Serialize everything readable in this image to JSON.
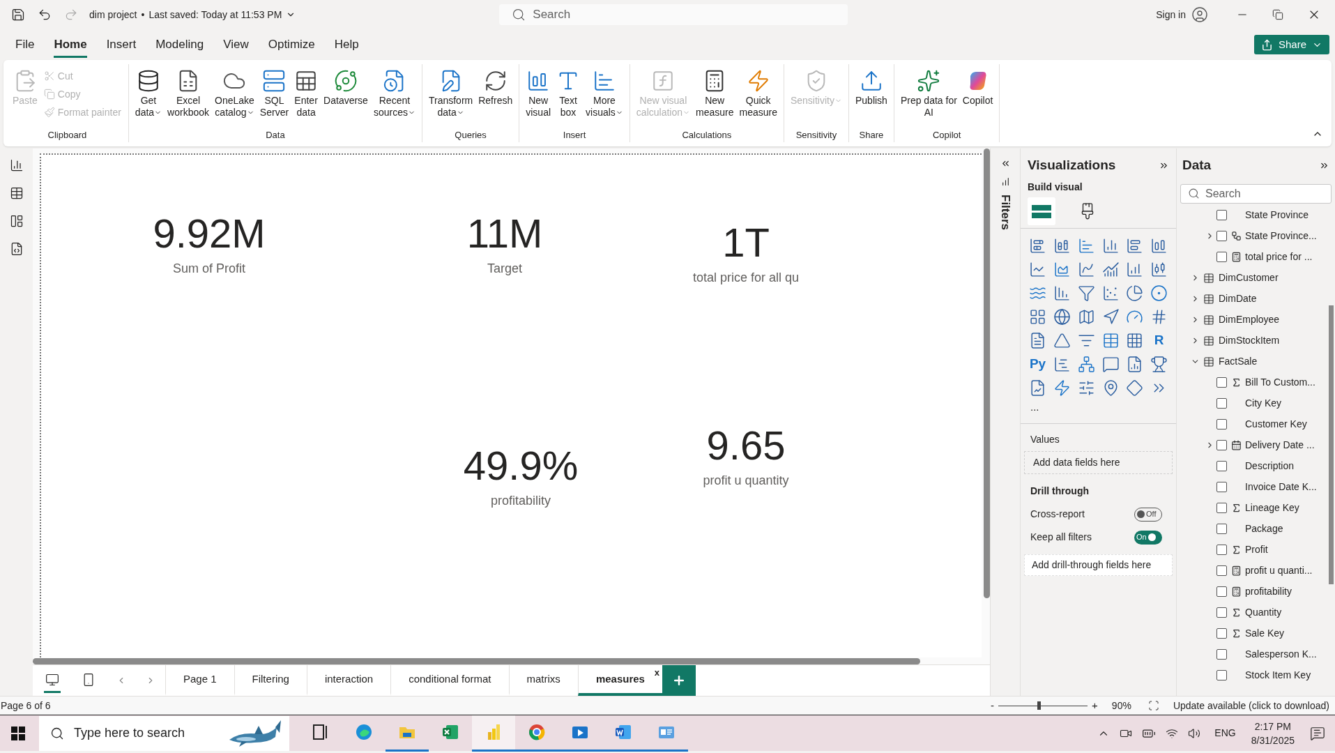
{
  "title_bar": {
    "file_name": "dim project",
    "separator": "•",
    "saved_status": "Last saved: Today at 11:53 PM",
    "search_placeholder": "Search",
    "sign_in": "Sign in"
  },
  "menu_tabs": [
    {
      "label": "File",
      "selected": false
    },
    {
      "label": "Home",
      "selected": true
    },
    {
      "label": "Insert",
      "selected": false
    },
    {
      "label": "Modeling",
      "selected": false
    },
    {
      "label": "View",
      "selected": false
    },
    {
      "label": "Optimize",
      "selected": false
    },
    {
      "label": "Help",
      "selected": false
    }
  ],
  "share_button": "Share",
  "ribbon": {
    "groups": [
      {
        "label": "Clipboard",
        "items": [
          {
            "kind": "large",
            "lines": [
              "Paste"
            ],
            "dropdown": false,
            "disabled": true
          },
          {
            "kind": "small",
            "lines": [
              "Cut"
            ],
            "disabled": true
          },
          {
            "kind": "small",
            "lines": [
              "Copy"
            ],
            "disabled": true
          },
          {
            "kind": "small",
            "lines": [
              "Format painter"
            ],
            "disabled": true
          }
        ]
      },
      {
        "label": "Data",
        "items": [
          {
            "kind": "large",
            "lines": [
              "Get",
              "data"
            ],
            "dropdown": true,
            "disabled": false
          },
          {
            "kind": "large",
            "lines": [
              "Excel",
              "workbook"
            ],
            "dropdown": false,
            "disabled": false
          },
          {
            "kind": "large",
            "lines": [
              "OneLake",
              "catalog"
            ],
            "dropdown": true,
            "disabled": false
          },
          {
            "kind": "large",
            "lines": [
              "SQL",
              "Server"
            ],
            "dropdown": false,
            "disabled": false
          },
          {
            "kind": "large",
            "lines": [
              "Enter",
              "data"
            ],
            "dropdown": false,
            "disabled": false
          },
          {
            "kind": "large",
            "lines": [
              "Dataverse"
            ],
            "dropdown": false,
            "disabled": false
          },
          {
            "kind": "large",
            "lines": [
              "Recent",
              "sources"
            ],
            "dropdown": true,
            "disabled": false
          }
        ]
      },
      {
        "label": "Queries",
        "items": [
          {
            "kind": "large",
            "lines": [
              "Transform",
              "data"
            ],
            "dropdown": true,
            "disabled": false
          },
          {
            "kind": "large",
            "lines": [
              "Refresh"
            ],
            "dropdown": false,
            "disabled": false
          }
        ]
      },
      {
        "label": "Insert",
        "items": [
          {
            "kind": "large",
            "lines": [
              "New",
              "visual"
            ],
            "dropdown": false,
            "disabled": false
          },
          {
            "kind": "large",
            "lines": [
              "Text",
              "box"
            ],
            "dropdown": false,
            "disabled": false
          },
          {
            "kind": "large",
            "lines": [
              "More",
              "visuals"
            ],
            "dropdown": true,
            "disabled": false
          }
        ]
      },
      {
        "label": "Calculations",
        "items": [
          {
            "kind": "large",
            "lines": [
              "New visual",
              "calculation"
            ],
            "dropdown": true,
            "disabled": true
          },
          {
            "kind": "large",
            "lines": [
              "New",
              "measure"
            ],
            "dropdown": false,
            "disabled": false
          },
          {
            "kind": "large",
            "lines": [
              "Quick",
              "measure"
            ],
            "dropdown": false,
            "disabled": false
          }
        ]
      },
      {
        "label": "Sensitivity",
        "items": [
          {
            "kind": "large",
            "lines": [
              "Sensitivity"
            ],
            "dropdown": true,
            "disabled": true
          }
        ]
      },
      {
        "label": "Share",
        "items": [
          {
            "kind": "large",
            "lines": [
              "Publish"
            ],
            "dropdown": false,
            "disabled": false
          }
        ]
      },
      {
        "label": "Copilot",
        "items": [
          {
            "kind": "large",
            "lines": [
              "Prep data for",
              "AI"
            ],
            "dropdown": false,
            "disabled": false
          },
          {
            "kind": "large",
            "lines": [
              "Copilot"
            ],
            "dropdown": false,
            "disabled": false
          }
        ]
      }
    ]
  },
  "cards": [
    {
      "value": "9.92M",
      "label": "Sum of Profit"
    },
    {
      "value": "11M",
      "label": "Target"
    },
    {
      "value": "1T",
      "label": "total price for all qu"
    },
    {
      "value": "49.9%",
      "label": "profitability"
    },
    {
      "value": "9.65",
      "label": "profit u quantity"
    }
  ],
  "filters_pane": {
    "label": "Filters"
  },
  "visualizations": {
    "title": "Visualizations",
    "subtitle": "Build visual",
    "tabs": [
      {
        "selected": true
      },
      {
        "selected": false
      }
    ],
    "text_icons": [
      "R",
      "Py"
    ],
    "more": "...",
    "values_label": "Values",
    "values_placeholder": "Add data fields here",
    "drill_title": "Drill through",
    "toggles": [
      {
        "label": "Cross-report",
        "on": false,
        "state_text": "Off"
      },
      {
        "label": "Keep all filters",
        "on": true,
        "state_text": "On"
      }
    ],
    "drill_placeholder": "Add drill-through fields here"
  },
  "data_pane": {
    "title": "Data",
    "search_placeholder": "Search",
    "items": [
      {
        "kind": "plain",
        "label": "State Province",
        "expandable": false,
        "checked": false
      },
      {
        "kind": "hierarchy",
        "label": "State Province...",
        "expandable": true,
        "checked": false
      },
      {
        "kind": "calc",
        "label": "total price for ...",
        "expandable": false,
        "checked": false
      },
      {
        "kind": "table",
        "label": "DimCustomer",
        "expanded": false
      },
      {
        "kind": "table",
        "label": "DimDate",
        "expanded": false
      },
      {
        "kind": "table",
        "label": "DimEmployee",
        "expanded": false
      },
      {
        "kind": "table",
        "label": "DimStockItem",
        "expanded": false
      },
      {
        "kind": "table",
        "label": "FactSale",
        "expanded": true,
        "children": [
          {
            "kind": "sum",
            "label": "Bill To Custom...",
            "expandable": false,
            "checked": false
          },
          {
            "kind": "plain",
            "label": "City Key",
            "expandable": false,
            "checked": false
          },
          {
            "kind": "plain",
            "label": "Customer Key",
            "expandable": false,
            "checked": false
          },
          {
            "kind": "date",
            "label": "Delivery Date ...",
            "expandable": true,
            "checked": false
          },
          {
            "kind": "plain",
            "label": "Description",
            "expandable": false,
            "checked": false
          },
          {
            "kind": "plain",
            "label": "Invoice Date K...",
            "expandable": false,
            "checked": false
          },
          {
            "kind": "sum",
            "label": "Lineage Key",
            "expandable": false,
            "checked": false
          },
          {
            "kind": "plain",
            "label": "Package",
            "expandable": false,
            "checked": false
          },
          {
            "kind": "sum",
            "label": "Profit",
            "expandable": false,
            "checked": false
          },
          {
            "kind": "calc",
            "label": "profit u quanti...",
            "expandable": false,
            "checked": false
          },
          {
            "kind": "calc",
            "label": "profitability",
            "expandable": false,
            "checked": false
          },
          {
            "kind": "sum",
            "label": "Quantity",
            "expandable": false,
            "checked": false
          },
          {
            "kind": "sum",
            "label": "Sale Key",
            "expandable": false,
            "checked": false
          },
          {
            "kind": "plain",
            "label": "Salesperson K...",
            "expandable": false,
            "checked": false
          },
          {
            "kind": "plain",
            "label": "Stock Item Key",
            "expandable": false,
            "checked": false
          }
        ]
      }
    ]
  },
  "page_tabs": {
    "views": [
      {
        "selected": true
      },
      {
        "selected": false
      }
    ],
    "tabs": [
      {
        "label": "Page 1",
        "selected": false
      },
      {
        "label": "Filtering",
        "selected": false
      },
      {
        "label": "interaction",
        "selected": false
      },
      {
        "label": "conditional format",
        "selected": false
      },
      {
        "label": "matrixs",
        "selected": false
      },
      {
        "label": "measures",
        "selected": true,
        "close": "x"
      }
    ]
  },
  "status_bar": {
    "page": "Page 6 of 6",
    "zoom_out": "-",
    "zoom_in": "+",
    "zoom_slider": {
      "level": 0.45
    },
    "zoom_text": "90%",
    "update": "Update available (click to download)"
  },
  "taskbar": {
    "search_placeholder": "Type here to search",
    "apps": [
      {
        "running": false,
        "active": false
      },
      {
        "running": false,
        "active": false
      },
      {
        "running": true,
        "active": false
      },
      {
        "running": false,
        "active": false
      },
      {
        "running": true,
        "active": true
      },
      {
        "running": true,
        "active": false
      },
      {
        "running": true,
        "active": false
      },
      {
        "running": true,
        "active": false
      },
      {
        "running": true,
        "active": false
      }
    ],
    "language": "ENG",
    "time": "2:17 PM",
    "date": "8/31/2025"
  }
}
